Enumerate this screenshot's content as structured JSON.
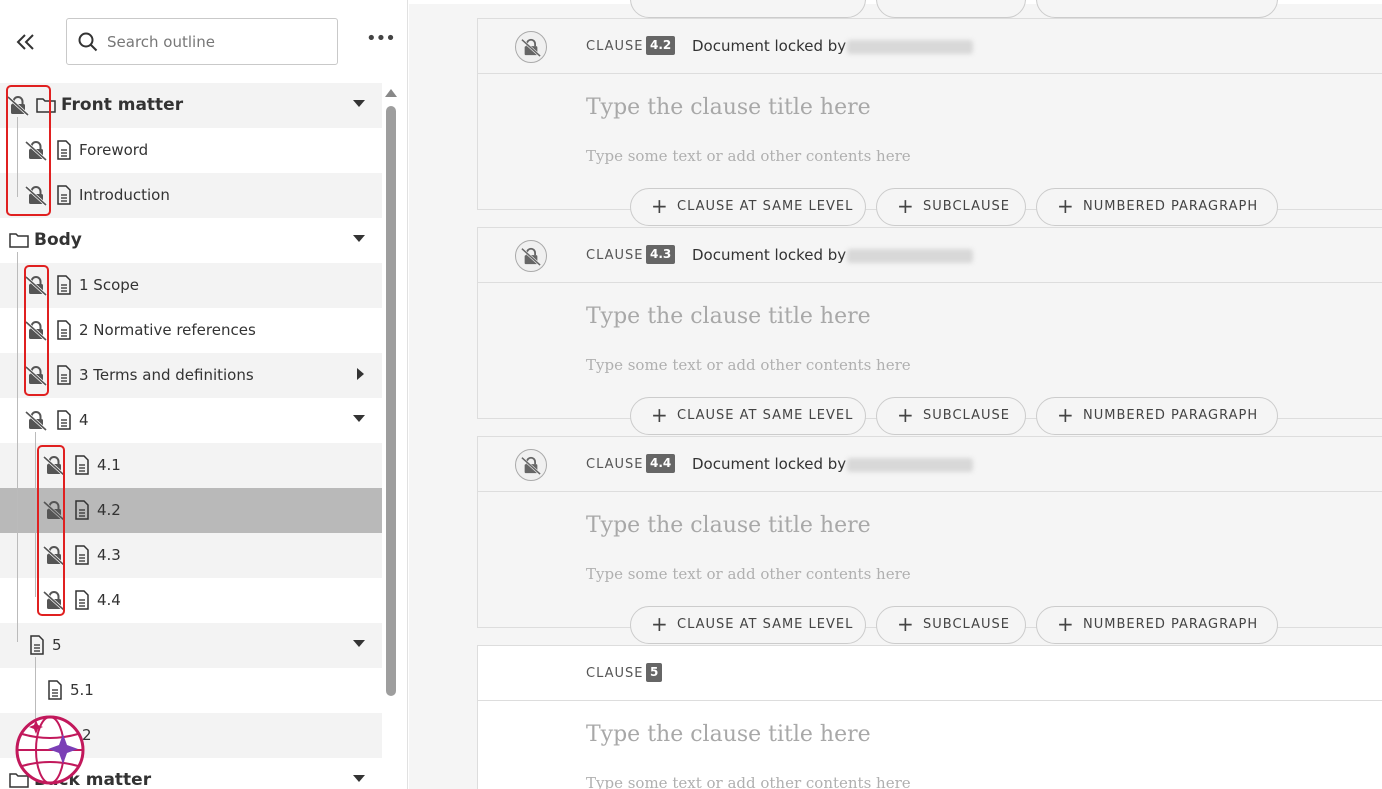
{
  "sidebar": {
    "search": {
      "placeholder": "Search outline"
    },
    "more_label": "•••",
    "tree": {
      "front_matter": "Front matter",
      "foreword": "Foreword",
      "introduction": "Introduction",
      "body": "Body",
      "scope": "1 Scope",
      "normative": "2 Normative references",
      "terms": "3 Terms and definitions",
      "c4": "4",
      "c4_1": "4.1",
      "c4_2": "4.2",
      "c4_3": "4.3",
      "c4_4": "4.4",
      "c5": "5",
      "c5_1": "5.1",
      "c5_2": "2",
      "back_matter": "Back matter"
    }
  },
  "main": {
    "clause_word": "CLAUSE",
    "locked_text": "Document locked by",
    "title_placeholder": "Type the clause title here",
    "text_placeholder": "Type some text or add other contents here",
    "buttons": {
      "same_level": "CLAUSE AT SAME LEVEL",
      "subclause": "SUBCLAUSE",
      "numbered": "NUMBERED PARAGRAPH"
    },
    "cards": [
      {
        "num": "4.2"
      },
      {
        "num": "4.3"
      },
      {
        "num": "4.4"
      },
      {
        "num": "5"
      }
    ]
  },
  "colors": {
    "highlight": "#e02020",
    "selected_row": "#b9b9b9",
    "logo": "#c2185b"
  }
}
